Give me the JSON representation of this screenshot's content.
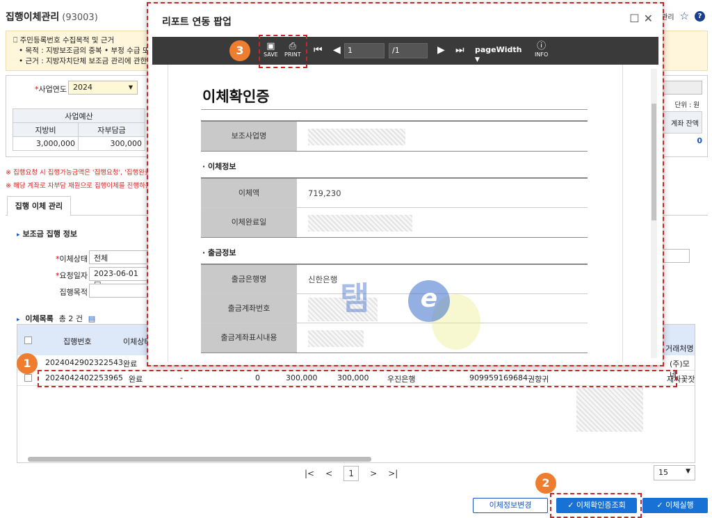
{
  "page": {
    "title": "집행이체관리",
    "code": "(93003)",
    "top_right_text": "관리"
  },
  "notice": {
    "heading": "주민등록번호 수집목적 및 근거",
    "line1": "• 목적 : 지방보조금의 중복 • 부정 수급 또는",
    "line2": "• 근거 : 지방자치단체 보조금 관리에 관한 법"
  },
  "filter": {
    "year_label": "사업연도",
    "year_value": "2024",
    "budget_header": "사업예산",
    "col_local": "지방비",
    "col_self": "자부담금",
    "val_local": "3,000,000",
    "val_self": "300,000",
    "unit": "단위 : 원",
    "balance_header": "계좌 잔액",
    "balance_value": "0"
  },
  "warnings": {
    "w1": "※ 집행요청 시 집행가능금액은 '집행요청', '집행완료'",
    "w2": "※ 해당 계좌로 자부담 재원으로 집행이체를 진행하는"
  },
  "tab": {
    "label": "집행 이체 관리"
  },
  "section": {
    "info_title": "보조금 집행 정보",
    "status_label": "이체상태",
    "status_value": "전체",
    "date_label": "요청일자",
    "date_value": "2023-06-01",
    "purpose_label": "집행목적",
    "list_title": "이체목록",
    "list_count": "총 2 건"
  },
  "grid": {
    "headers": {
      "exec_no": "집행번호",
      "status": "이체상태",
      "trader": "거래처명"
    },
    "rows": [
      {
        "exec_no": "2024042902322543",
        "status": "완료",
        "trader": "(주)모네"
      },
      {
        "exec_no": "2024042402253965",
        "status": "완료",
        "dash": "-",
        "zero": "0",
        "amt1": "300,000",
        "amt2": "300,000",
        "bank": "우진은행",
        "account": "909959169684",
        "holder": "권향귀",
        "trader": "재싸꽃잣"
      }
    ]
  },
  "pager": {
    "first": "|<",
    "prev": "<",
    "current": "1",
    "next": ">",
    "last": ">|",
    "page_size": "15"
  },
  "buttons": {
    "change_info": "이체정보변경",
    "cert_lookup": "✓ 이체확인증조회",
    "execute": "✓ 이체실행"
  },
  "badges": {
    "b1": "1",
    "b2": "2",
    "b3": "3"
  },
  "popup": {
    "title": "리포트 연동 팝업",
    "toolbar": {
      "save": "SAVE",
      "print": "PRINT",
      "page_input": "1",
      "page_total": "/1",
      "zoom": "pageWidth",
      "info": "INFO"
    },
    "report": {
      "title": "이체확인증",
      "project_label": "보조사업명",
      "transfer_section": "이체정보",
      "amount_label": "이체액",
      "amount_value": "719,230",
      "done_date_label": "이체완료일",
      "withdraw_section": "출금정보",
      "bank_label": "출금은행명",
      "bank_value": "신한은행",
      "account_label": "출금계좌번호",
      "memo_label": "출금계좌표시내용"
    },
    "watermark": "탬"
  },
  "colors": {
    "accent": "#1872d6",
    "highlight": "#c62828",
    "badge": "#ee7d2f"
  }
}
